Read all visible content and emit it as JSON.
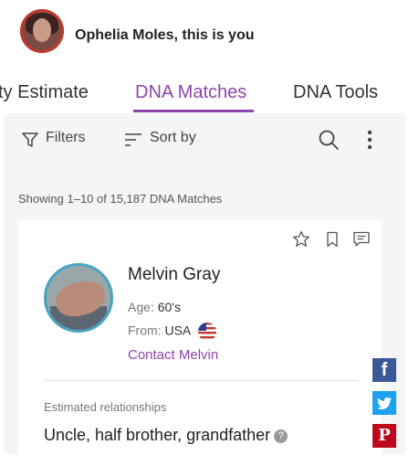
{
  "header": {
    "title": "Ophelia Moles, this is you"
  },
  "tabs": [
    {
      "label": "ty Estimate",
      "active": false
    },
    {
      "label": "DNA Matches",
      "active": true
    },
    {
      "label": "DNA Tools",
      "active": false
    }
  ],
  "toolbar": {
    "filters_label": "Filters",
    "sort_label": "Sort by"
  },
  "results": {
    "showing_text": "Showing 1–10 of 15,187 DNA Matches"
  },
  "match": {
    "name": "Melvin Gray",
    "age_label": "Age: ",
    "age_value": "60's",
    "from_label": "From: ",
    "from_value": "USA",
    "contact_label": "Contact Melvin",
    "relationship_label": "Estimated relationships",
    "relationship_value": "Uncle, half brother, grandfather",
    "help_symbol": "?"
  },
  "social": [
    {
      "name": "facebook",
      "glyph": "f",
      "color": "#3b5998"
    },
    {
      "name": "twitter",
      "glyph": "t",
      "color": "#1da1f2"
    },
    {
      "name": "pinterest",
      "glyph": "P",
      "color": "#bd081c"
    }
  ],
  "colors": {
    "accent": "#8e44ad",
    "panel_bg": "#f5f5f6"
  }
}
